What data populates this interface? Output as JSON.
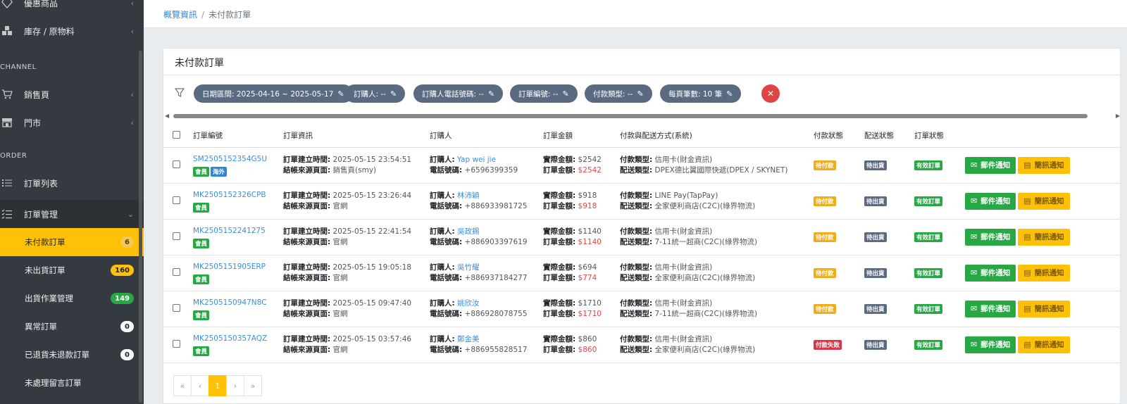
{
  "sidebar": {
    "items": [
      {
        "label": "優惠商品",
        "icon": "diamond-icon"
      },
      {
        "label": "庫存 / 原物料",
        "icon": "boxes-icon"
      },
      {
        "label": "銷售頁",
        "icon": "cart-icon"
      },
      {
        "label": "門市",
        "icon": "store-icon"
      },
      {
        "label": "訂單列表",
        "icon": "list-icon"
      },
      {
        "label": "訂單管理",
        "icon": "tasks-icon"
      }
    ],
    "sections": {
      "channel": "CHANNEL",
      "order": "ORDER"
    },
    "sub_items": [
      {
        "label": "未付款訂單",
        "badge": "6"
      },
      {
        "label": "未出貨訂單",
        "badge": "160"
      },
      {
        "label": "出貨作業管理",
        "badge": "149"
      },
      {
        "label": "異常訂單",
        "badge": "0"
      },
      {
        "label": "已退貨未退款訂單",
        "badge": "0"
      },
      {
        "label": "未處理留言訂單",
        "badge": ""
      }
    ]
  },
  "breadcrumb": {
    "home": "概覽資訊",
    "separator": "/",
    "current": "未付款訂單"
  },
  "card": {
    "title": "未付款訂單"
  },
  "filters": [
    "日期區間: 2025-04-16 ~ 2025-05-17",
    "訂購人: --",
    "訂購人電話號碼: --",
    "訂單編號: --",
    "付款類型: --",
    "每頁筆數: 10 筆"
  ],
  "table": {
    "headers": [
      "訂單編號",
      "訂單資訊",
      "訂購人",
      "訂單金額",
      "付款與配送方式(系統)",
      "付款狀態",
      "配送狀態",
      "訂單狀態"
    ],
    "labels": {
      "created": "訂單建立時間:",
      "source": "結帳來源頁面:",
      "buyer": "訂購人:",
      "phone": "電話號碼:",
      "actual": "實際金額:",
      "amount": "訂單金額:",
      "pay_type": "付款類型:",
      "ship_type": "配送類型:",
      "mail_btn": "郵件通知",
      "sms_btn": "簡訊通知"
    },
    "rows": [
      {
        "no": "SM2505152354G5U",
        "tags": [
          "會員",
          "海外"
        ],
        "created": "2025-05-15 23:54:51",
        "source": "銷售頁(smy)",
        "buyer": "Yap wei jie",
        "phone": "+6596399359",
        "actual": "$2542",
        "amount": "$2542",
        "pay": "信用卡(財金資訊)",
        "ship": "DPEX德比翼國際快遞(DPEX / SKYNET)",
        "pay_status": "待付款",
        "ship_status": "待出貨",
        "order_status": "有效訂單"
      },
      {
        "no": "MK2505152326CPB",
        "tags": [
          "會員"
        ],
        "created": "2025-05-15 23:26:44",
        "source": "官網",
        "buyer": "林沛穎",
        "phone": "+886933981725",
        "actual": "$918",
        "amount": "$918",
        "pay": "LINE Pay(TapPay)",
        "ship": "全家便利商店(C2C)(綠界物流)",
        "pay_status": "待付款",
        "ship_status": "待出貨",
        "order_status": "有效訂單"
      },
      {
        "no": "MK2505152241275",
        "tags": [
          "會員"
        ],
        "created": "2025-05-15 22:41:54",
        "source": "官網",
        "buyer": "吳政錫",
        "phone": "+886903397619",
        "actual": "$1140",
        "amount": "$1140",
        "pay": "信用卡(財金資訊)",
        "ship": "7-11統一超商(C2C)(綠界物流)",
        "pay_status": "待付款",
        "ship_status": "待出貨",
        "order_status": "有效訂單"
      },
      {
        "no": "MK2505151905ERP",
        "tags": [
          "會員"
        ],
        "created": "2025-05-15 19:05:18",
        "source": "官網",
        "buyer": "吳竹耀",
        "phone": "+886937184277",
        "actual": "$694",
        "amount": "$774",
        "pay": "信用卡(財金資訊)",
        "ship": "全家便利商店(C2C)(綠界物流)",
        "pay_status": "待付款",
        "ship_status": "待出貨",
        "order_status": "有效訂單"
      },
      {
        "no": "MK2505150947N8C",
        "tags": [
          "會員"
        ],
        "created": "2025-05-15 09:47:40",
        "source": "官網",
        "buyer": "姚欣汝",
        "phone": "+886928078755",
        "actual": "$1710",
        "amount": "$1710",
        "pay": "信用卡(財金資訊)",
        "ship": "7-11統一超商(C2C)(綠界物流)",
        "pay_status": "待付款",
        "ship_status": "待出貨",
        "order_status": "有效訂單"
      },
      {
        "no": "MK2505150357AQZ",
        "tags": [
          "會員"
        ],
        "created": "2025-05-15 03:57:46",
        "source": "官網",
        "buyer": "鄭金美",
        "phone": "+886955828517",
        "actual": "$860",
        "amount": "$860",
        "pay": "信用卡(財金資訊)",
        "ship": "全家便利商店(C2C)(綠界物流)",
        "pay_status": "付款失敗",
        "ship_status": "待出貨",
        "order_status": "有效訂單"
      }
    ]
  },
  "pagination": {
    "first": "«",
    "prev": "‹",
    "current": "1",
    "next": "›",
    "last": "»"
  },
  "colors": {
    "sidebar": "#343a40",
    "accent": "#ffc107",
    "link": "#3b8fd8",
    "success": "#28a745",
    "danger": "#e04545"
  }
}
